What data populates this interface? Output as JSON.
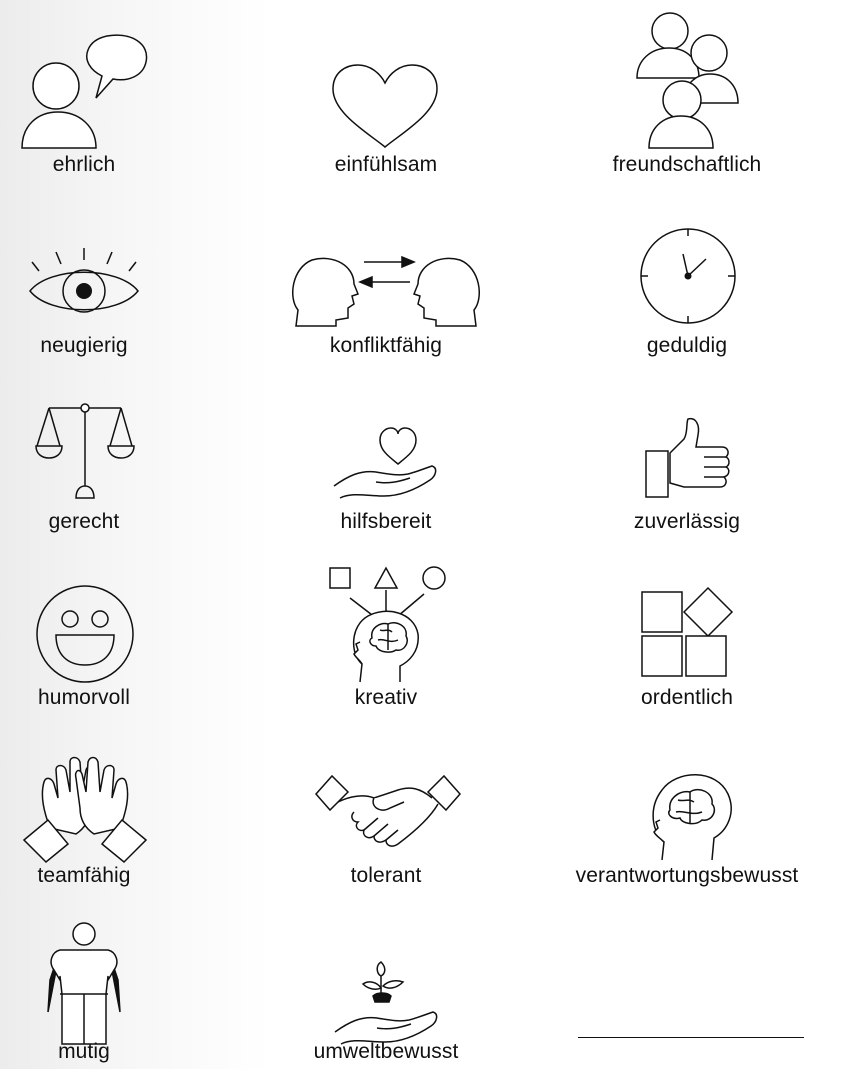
{
  "traits": [
    {
      "label": "ehrlich",
      "icon": "speech-bubble-person-icon"
    },
    {
      "label": "einfühlsam",
      "icon": "heart-icon"
    },
    {
      "label": "freundschaftlich",
      "icon": "group-people-icon"
    },
    {
      "label": "neugierig",
      "icon": "eye-icon"
    },
    {
      "label": "konfliktfähig",
      "icon": "two-heads-arrows-icon"
    },
    {
      "label": "geduldig",
      "icon": "clock-icon"
    },
    {
      "label": "gerecht",
      "icon": "scales-icon"
    },
    {
      "label": "hilfsbereit",
      "icon": "helping-hand-heart-icon"
    },
    {
      "label": "zuverlässig",
      "icon": "thumbs-up-icon"
    },
    {
      "label": "humorvoll",
      "icon": "smiley-icon"
    },
    {
      "label": "kreativ",
      "icon": "creative-head-shapes-icon"
    },
    {
      "label": "ordentlich",
      "icon": "squares-order-icon"
    },
    {
      "label": "teamfähig",
      "icon": "high-five-hands-icon"
    },
    {
      "label": "tolerant",
      "icon": "handshake-icon"
    },
    {
      "label": "verantwortungsbewusst",
      "icon": "head-brain-icon"
    },
    {
      "label": "mutig",
      "icon": "hero-cape-icon"
    },
    {
      "label": "umweltbewusst",
      "icon": "hand-plant-icon"
    }
  ],
  "blank_entry": {
    "label": ""
  }
}
